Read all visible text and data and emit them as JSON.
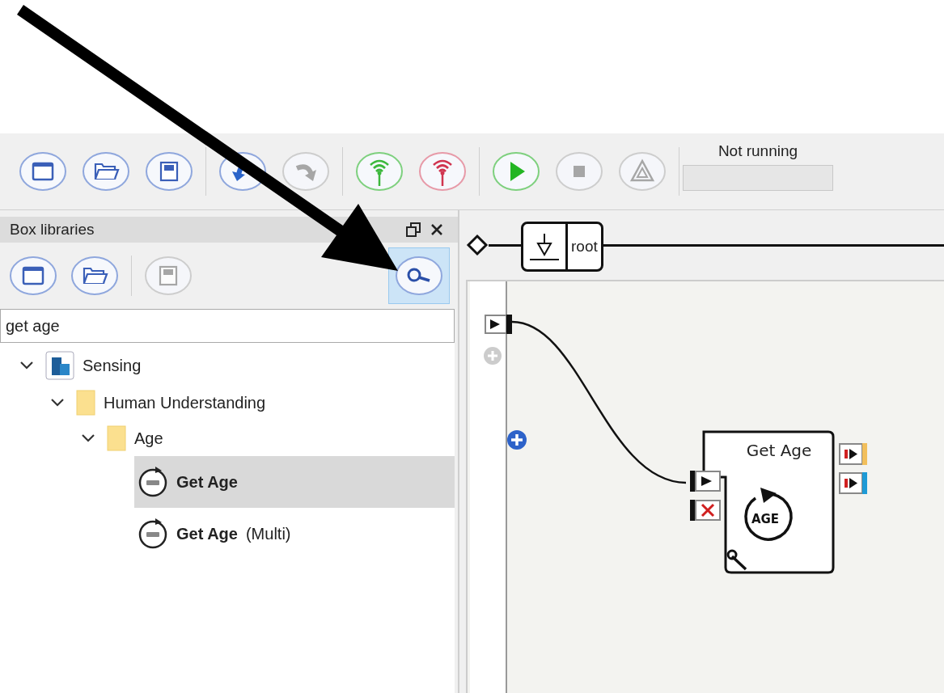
{
  "toolbar": {
    "groups": [
      [
        {
          "kind": "new",
          "disabled": false
        },
        {
          "kind": "open",
          "disabled": false
        },
        {
          "kind": "save",
          "disabled": false
        }
      ],
      [
        {
          "kind": "undo",
          "disabled": false
        },
        {
          "kind": "redo",
          "disabled": true
        }
      ],
      [
        {
          "kind": "connect",
          "disabled": false
        },
        {
          "kind": "disconnect",
          "disabled": false
        }
      ],
      [
        {
          "kind": "play",
          "disabled": false
        },
        {
          "kind": "stop",
          "disabled": true
        },
        {
          "kind": "warning",
          "disabled": true
        }
      ]
    ],
    "status": "Not running"
  },
  "box_libraries": {
    "title": "Box libraries",
    "buttons": [
      {
        "kind": "new",
        "disabled": false
      },
      {
        "kind": "open",
        "disabled": false
      },
      {
        "kind": "save",
        "disabled": true
      }
    ],
    "search_button": {
      "selected": true
    },
    "search": {
      "value": "get age"
    },
    "tree": [
      {
        "label": "Sensing",
        "kind": "library",
        "expanded": true,
        "selected": false,
        "bold": false,
        "children": [
          {
            "label": "Human Understanding",
            "kind": "folder",
            "expanded": true,
            "selected": false,
            "bold": false,
            "children": [
              {
                "label": "Age",
                "kind": "folder",
                "expanded": true,
                "selected": false,
                "bold": false,
                "children": [
                  {
                    "label": "Get Age",
                    "kind": "box",
                    "selected": true,
                    "bold": true
                  },
                  {
                    "label": "**Get Age** (Multi)",
                    "kind": "box",
                    "selected": false,
                    "bold": false
                  }
                ]
              }
            ]
          }
        ]
      }
    ]
  },
  "canvas": {
    "breadcrumb": "root",
    "box": {
      "title": "Get Age",
      "icon_label": "AGE"
    }
  }
}
